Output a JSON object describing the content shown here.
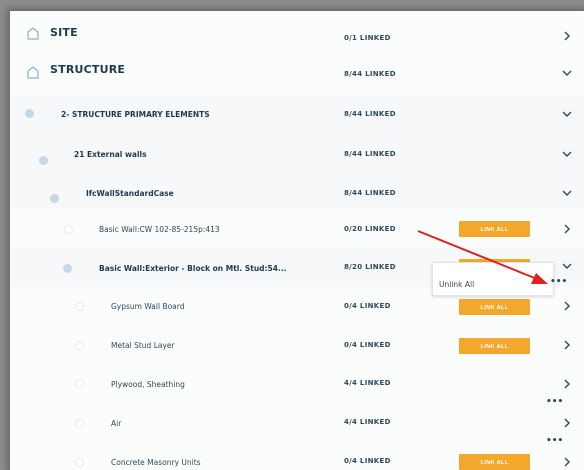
{
  "rows": [
    {
      "label": "SITE",
      "status": "0/1 LINKED",
      "expanded": false
    },
    {
      "label": "STRUCTURE",
      "status": "8/44 LINKED",
      "expanded": true
    },
    {
      "label": "2- STRUCTURE PRIMARY ELEMENTS",
      "status": "8/44 LINKED",
      "expanded": true
    },
    {
      "label": "21 External walls",
      "status": "8/44 LINKED",
      "expanded": true
    },
    {
      "label": "IfcWallStandardCase",
      "status": "8/44 LINKED",
      "expanded": true
    },
    {
      "label": "Basic Wall:CW 102-85-215p:413",
      "status": "0/20 LINKED",
      "button": "LINK ALL",
      "expanded": false
    },
    {
      "label": "Basic Wall:Exterior - Block on Mtl. Stud:54...",
      "status": "8/20 LINKED",
      "expanded": true
    },
    {
      "label": "Gypsum Wall Board",
      "status": "0/4 LINKED",
      "button": "LINK ALL",
      "expanded": false
    },
    {
      "label": "Metal Stud Layer",
      "status": "0/4 LINKED",
      "button": "LINK ALL",
      "expanded": false
    },
    {
      "label": "Plywood, Sheathing",
      "status": "4/4 LINKED",
      "expanded": false
    },
    {
      "label": "Air",
      "status": "4/4 LINKED",
      "expanded": false
    },
    {
      "label": "Concrete Masonry Units",
      "status": "0/4 LINKED",
      "button": "LINK ALL",
      "expanded": false
    }
  ],
  "menu": {
    "unlink_all": "Unlink All",
    "more": "•••"
  },
  "icons": {
    "home": "home-outline-icon",
    "chevron_right": "chevron-right-icon",
    "chevron_down": "chevron-down-icon"
  },
  "colors": {
    "accent": "#f3a82d",
    "arrow": "#e02020",
    "node": "#c5d8e3"
  }
}
